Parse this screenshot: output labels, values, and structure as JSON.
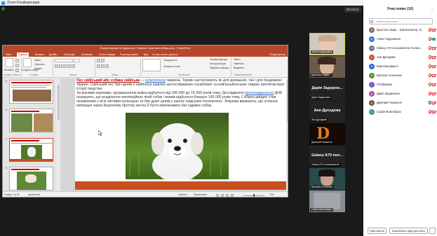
{
  "window": {
    "title": "Zoom Конференция"
  },
  "meeting": {
    "timer": "00:16:22"
  },
  "ppt": {
    "title": "Фізичні вправи та будиночок. Тварини: Анатомія собаки.pptx - PowerPoint",
    "tabs": [
      "Файл",
      "Главная",
      "Вставка",
      "Дизайн",
      "Переходы",
      "Анимация",
      "Показ слайдов",
      "Рецензирование",
      "Вид",
      "Что вы хотите сделать?"
    ],
    "active_tab": "Главная",
    "share_label": "Общий доступ",
    "ribbon": {
      "paste": "Вставить",
      "create_slide": "Создать слайд",
      "macet": "Макет",
      "reset": "Сбросить",
      "section": "Раздел",
      "fill": "Заливка фигуры",
      "outline": "Контур фигуры",
      "effects": "Эффекты фигуры",
      "find": "Найти",
      "replace": "Заменить",
      "select": "Выделить",
      "arrange": "Упорядочить",
      "quick_styles": "Экспресс-стили",
      "groups": [
        "Буфер обмена",
        "Слайды",
        "Шрифт",
        "Абзац",
        "Рисование",
        "Редактирование"
      ]
    },
    "thumbnails": [
      "5",
      "6",
      "7",
      "8"
    ],
    "selected_thumb": "7",
    "slide": {
      "heading_red": "Пес свійський або собака свійська",
      "heading_dash": " — ",
      "heading_link": "культигенна",
      "heading_rest": " тварина. Термін застосовують як для домашніх, так і для бездомних тварин. Свійський пес був одним з найбільш широко застосовуваних службових та компаньйонських тварин протягом всієї історії людства.",
      "body_pre": "За різними оцінками, одомашнення вовка відбулося від 100 000 до 15 000 років тому. Дослідження ",
      "body_link": "мітохондріальної",
      "body_post": " ДНК показують, що розділення еволюційних ліній собак і вовків відбулося близько 100 000 років тому. Собака швидко став незамінним у всіх світових культурах та був дуже ціним у ранніх людських поселеннях. Зокрема вважають, що успішна еміграція через Берингову протоку могла б бути неможливою без їздових собак."
    },
    "status": {
      "slide": "Слайд 7 из 18",
      "lang": "украинский",
      "notes": "Заметки",
      "comments": "Примечания",
      "zoom": "73%"
    }
  },
  "tiles": [
    {
      "name": "Аліна Гордошніна",
      "kind": "video"
    },
    {
      "name": "Кристіна Свіден...",
      "kind": "video"
    },
    {
      "name": "Дарія Задорожна",
      "big": "Дарія Задорож...",
      "kind": "name"
    },
    {
      "name": "Аня Дроздова",
      "big": "Аня Дроздова",
      "kind": "name"
    },
    {
      "name": "Дмитрий Черкасов",
      "kind": "video"
    },
    {
      "name": "Galaxy A70 пользователь",
      "big": "Galaxy A70 пол...",
      "kind": "name"
    },
    {
      "name": "Валерія Антоненко",
      "kind": "video"
    },
    {
      "name": "Софія Жовтобрюх",
      "kind": "video"
    }
  ],
  "participants": {
    "title": "Участники (10)",
    "search_placeholder": "Найти участника",
    "list": [
      {
        "name": "Кристіна Свіде... (Организатор, я)",
        "initial": "К",
        "color": "#8e6b5a",
        "mic": false,
        "cam": false
      },
      {
        "name": "Аліна Гордошніна",
        "initial": "А",
        "color": "#2d7fd6",
        "mic": false,
        "cam": true
      },
      {
        "name": "Galaxy A70 пользователь Галакс...",
        "initial": "G",
        "color": "#6b7b8e",
        "mic": false,
        "cam": false
      },
      {
        "name": "Аня Дроздова",
        "initial": "А",
        "color": "#d24b36",
        "mic": false,
        "cam": false
      },
      {
        "name": "Вероніка Даць'я",
        "initial": "В",
        "color": "#2e6bd6",
        "mic": false,
        "cam": false
      },
      {
        "name": "Валерія Антоненко",
        "initial": "В",
        "color": "#5d8f3a",
        "mic": false,
        "cam": false
      },
      {
        "name": "Глеб(мама)",
        "initial": "Г",
        "color": "#7a55c8",
        "mic": false,
        "cam": false
      },
      {
        "name": "Дарія Задорожна",
        "initial": "Д",
        "color": "#b04aa0",
        "mic": false,
        "cam": false
      },
      {
        "name": "Дмитрий Черкасов",
        "initial": "Д",
        "color": "#7a4d3a",
        "mic": true,
        "cam": false
      },
      {
        "name": "Софія Жовтобрюх",
        "initial": "С",
        "color": "#3e9a8a",
        "mic": false,
        "cam": false
      }
    ],
    "invite_label": "Пригласить",
    "mute_all_label": "Выключить звук для всех",
    "more_label": "..."
  }
}
